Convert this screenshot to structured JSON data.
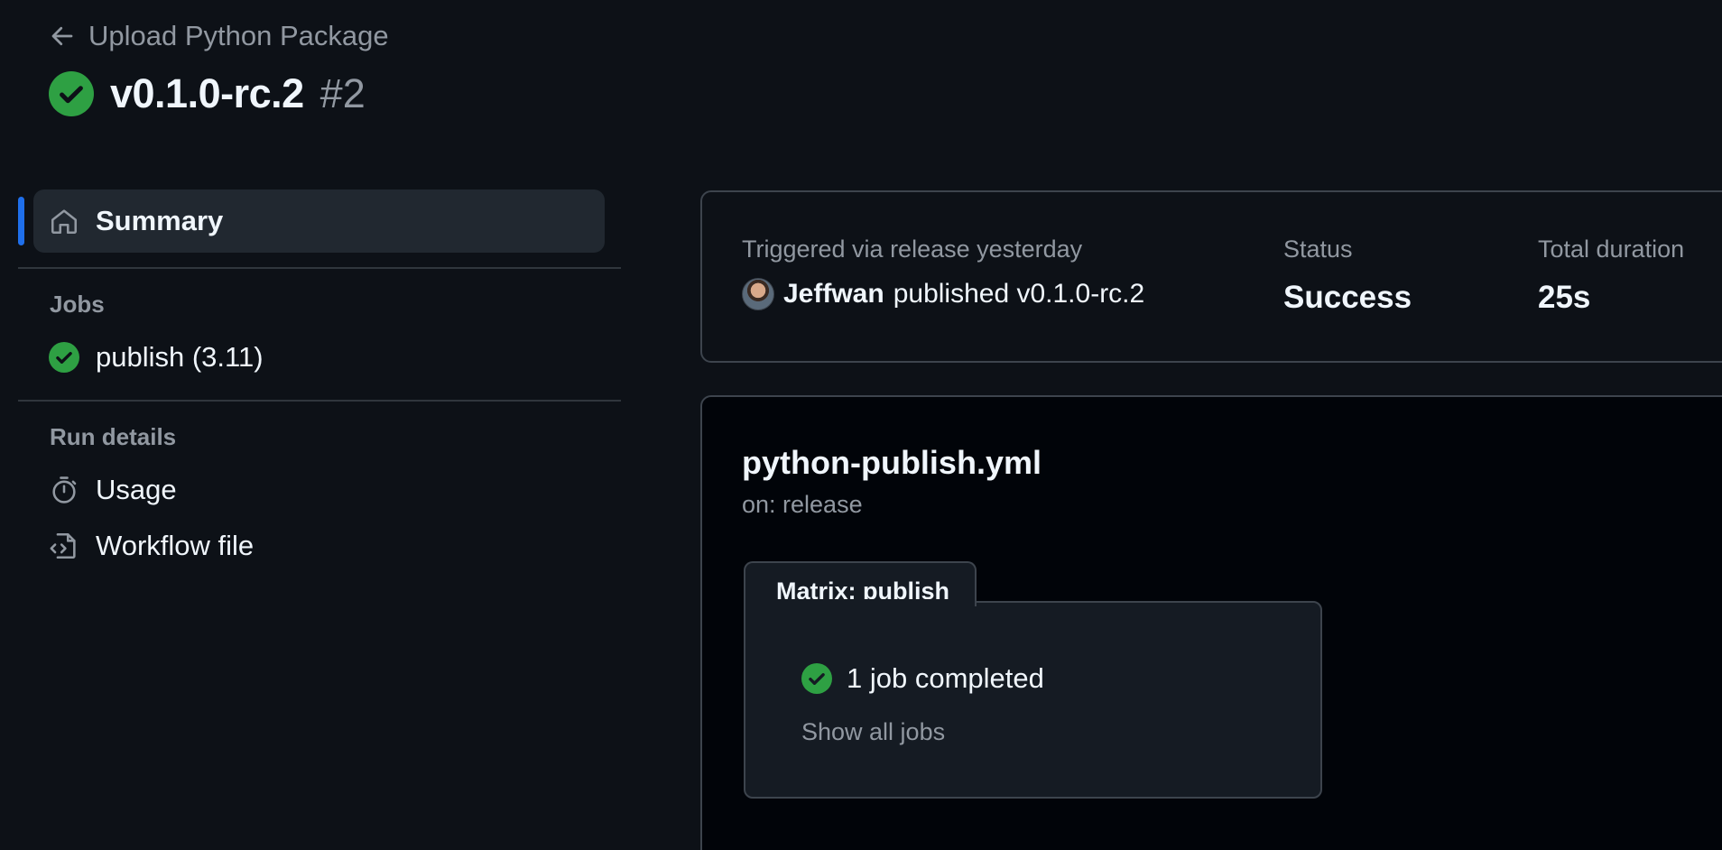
{
  "header": {
    "back_label": "Upload Python Package",
    "run_name": "v0.1.0-rc.2",
    "run_number": "#2",
    "status_color": "#238636"
  },
  "sidebar": {
    "summary_label": "Summary",
    "jobs_heading": "Jobs",
    "jobs": [
      {
        "label": "publish (3.11)",
        "status": "success"
      }
    ],
    "run_details_heading": "Run details",
    "details": [
      {
        "label": "Usage",
        "icon": "stopwatch-icon"
      },
      {
        "label": "Workflow file",
        "icon": "file-code-icon"
      }
    ],
    "active_color": "#1f6feb"
  },
  "summary": {
    "triggered_label": "Triggered via release yesterday",
    "actor": "Jeffwan",
    "action_text": "published v0.1.0-rc.2",
    "status_label": "Status",
    "status_value": "Success",
    "duration_label": "Total duration",
    "duration_value": "25s"
  },
  "workflow": {
    "file_name": "python-publish.yml",
    "trigger": "on: release",
    "matrix_label": "Matrix: publish",
    "jobs_completed": "1 job completed",
    "show_all_label": "Show all jobs"
  }
}
